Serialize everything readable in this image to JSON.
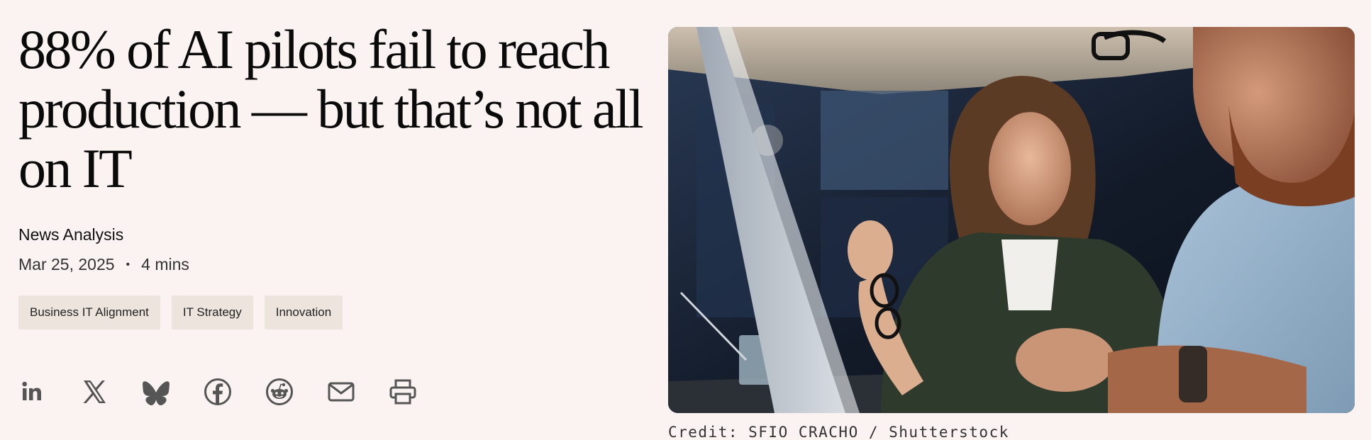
{
  "article": {
    "headline": "88% of AI pilots fail to reach production — but that’s not all on IT",
    "type": "News Analysis",
    "date": "Mar 25, 2025",
    "separator": "•",
    "read_time": "4 mins",
    "tags": [
      "Business IT Alignment",
      "IT Strategy",
      "Innovation"
    ]
  },
  "share": {
    "icons": [
      "linkedin-icon",
      "x-icon",
      "bluesky-icon",
      "facebook-icon",
      "reddit-icon",
      "email-icon",
      "print-icon"
    ]
  },
  "image": {
    "credit": "Credit: SFIO CRACHO / Shutterstock"
  },
  "colors": {
    "background": "#fbf3f1",
    "tag_background": "#ece4dd",
    "icon": "#555555"
  }
}
